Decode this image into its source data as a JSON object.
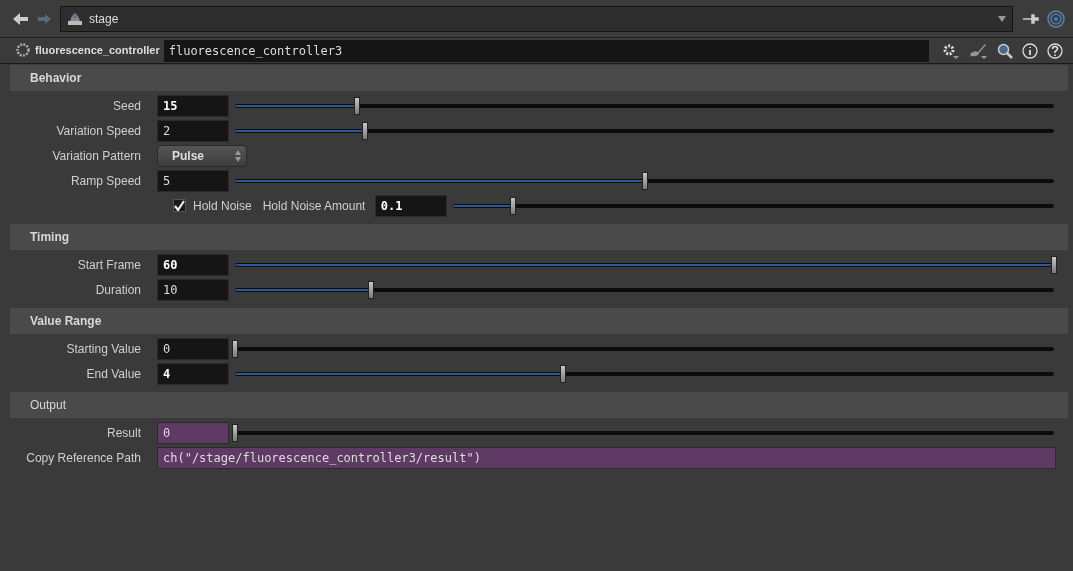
{
  "path_bar": {
    "value": "stage"
  },
  "node": {
    "type_label": "fluorescence_controller",
    "name": "fluorescence_controller3"
  },
  "sections": [
    {
      "title": "Behavior",
      "modified": true,
      "rows": [
        {
          "kind": "slider",
          "label": "Seed",
          "value": "15",
          "modified": true,
          "locked": false,
          "level": 0.149
        },
        {
          "kind": "slider",
          "label": "Variation Speed",
          "value": "2",
          "modified": false,
          "locked": false,
          "level": 0.159
        },
        {
          "kind": "menu",
          "label": "Variation Pattern",
          "value": "Pulse"
        },
        {
          "kind": "slider",
          "label": "Ramp Speed",
          "value": "5",
          "modified": false,
          "locked": false,
          "level": 0.5
        },
        {
          "kind": "toggle",
          "label": "Hold Noise",
          "checked": true,
          "sub_label": "Hold Noise Amount",
          "value": "0.1",
          "modified": true,
          "level": 0.1
        }
      ]
    },
    {
      "title": "Timing",
      "modified": true,
      "rows": [
        {
          "kind": "slider",
          "label": "Start Frame",
          "value": "60",
          "modified": true,
          "locked": false,
          "level": 1.0
        },
        {
          "kind": "slider",
          "label": "Duration",
          "value": "10",
          "modified": false,
          "locked": false,
          "level": 0.166
        }
      ]
    },
    {
      "title": "Value Range",
      "modified": true,
      "rows": [
        {
          "kind": "slider",
          "label": "Starting Value",
          "value": "0",
          "modified": false,
          "locked": false,
          "level": 0
        },
        {
          "kind": "slider",
          "label": "End Value",
          "value": "4",
          "modified": true,
          "locked": false,
          "level": 0.4
        }
      ]
    },
    {
      "title": "Output",
      "modified": false,
      "rows": [
        {
          "kind": "slider",
          "label": "Result",
          "value": "0",
          "modified": false,
          "locked": true,
          "level": 0
        },
        {
          "kind": "string",
          "label": "Copy Reference Path",
          "value": "ch(\"/stage/fluorescence_controller3/result\")",
          "locked": true
        }
      ]
    }
  ]
}
